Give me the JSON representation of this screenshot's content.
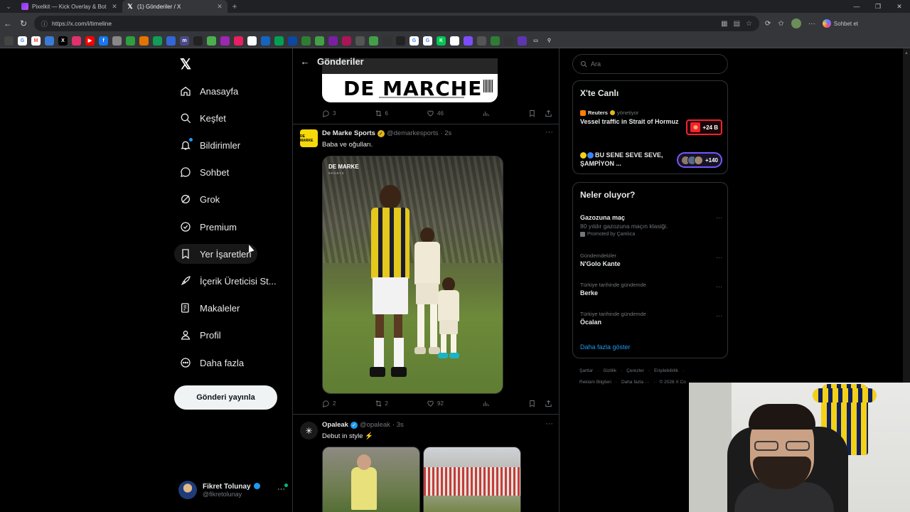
{
  "browser": {
    "tabs": [
      {
        "title": "Pixelkit — Kick Overlay & Bot",
        "active": false
      },
      {
        "title": "(1) Gönderiler / X",
        "active": true
      }
    ],
    "url": "https://x.com/i/timeline",
    "copilot_label": "Sohbet et"
  },
  "nav": {
    "items": [
      {
        "label": "Anasayfa",
        "icon": "home-icon"
      },
      {
        "label": "Keşfet",
        "icon": "search-icon"
      },
      {
        "label": "Bildirimler",
        "icon": "bell-icon"
      },
      {
        "label": "Sohbet",
        "icon": "chat-icon"
      },
      {
        "label": "Grok",
        "icon": "grok-icon"
      },
      {
        "label": "Premium",
        "icon": "premium-icon"
      },
      {
        "label": "Yer İşaretleri",
        "icon": "bookmark-icon"
      },
      {
        "label": "İçerik Üreticisi St...",
        "icon": "rocket-icon"
      },
      {
        "label": "Makaleler",
        "icon": "article-icon"
      },
      {
        "label": "Profil",
        "icon": "person-icon"
      },
      {
        "label": "Daha fazla",
        "icon": "more-circle-icon"
      }
    ],
    "post_button": "Gönderi yayınla",
    "account": {
      "name": "Fikret Tolunay",
      "handle": "@fikretolunay"
    }
  },
  "timeline": {
    "header_title": "Gönderiler",
    "prev_post": {
      "image_text": "DE MARCHE",
      "replies": "3",
      "reposts": "6",
      "likes": "46"
    },
    "posts": [
      {
        "name": "De Marke Sports",
        "handle": "@demarkesports",
        "time": "· 2s",
        "text": "Baba ve oğulları.",
        "image_brand": "DE MARKE",
        "image_brand_sub": "SPORTS",
        "replies": "2",
        "reposts": "2",
        "likes": "92"
      },
      {
        "name": "Opaleak",
        "handle": "@opaleak",
        "time": "· 3s",
        "text": "Debut in style ⚡"
      }
    ]
  },
  "sidebar": {
    "search_placeholder": "Ara",
    "live": {
      "title": "X'te Canlı",
      "items": [
        {
          "source": "Reuters",
          "role": "yönetiyor",
          "headline": "Vessel traffic in Strait of Hormuz",
          "count": "+24 B"
        },
        {
          "headline": "BU SENE SEVE SEVE, ŞAMPİYON ...",
          "count": "+140"
        }
      ]
    },
    "trends": {
      "title": "Neler oluyor?",
      "items": [
        {
          "category": "",
          "title": "Gazozuna maç",
          "desc": "80 yıldır gazozuna maçın klasiği.",
          "promo": "Promoted by Çamlıca"
        },
        {
          "category": "Gündemdekiler",
          "title": "N'Golo Kante"
        },
        {
          "category": "Türkiye tarihinde gündemde",
          "title": "Berke"
        },
        {
          "category": "Türkiye tarihinde gündemde",
          "title": "Öcalan"
        }
      ],
      "show_more": "Daha fazla göster"
    },
    "footer": {
      "row1": [
        "Şartlar",
        "Gizlilik",
        "Çerezler",
        "Erişilebilirlik",
        "·"
      ],
      "row2": [
        "Reklam Bilgileri",
        "Daha fazla ···",
        "© 2026 X Co"
      ]
    }
  },
  "colors": {
    "accent": "#1d9bf0",
    "border": "#2f3336",
    "muted": "#71767b",
    "live_red": "#f4212e",
    "live_purple": "#7856ff"
  }
}
